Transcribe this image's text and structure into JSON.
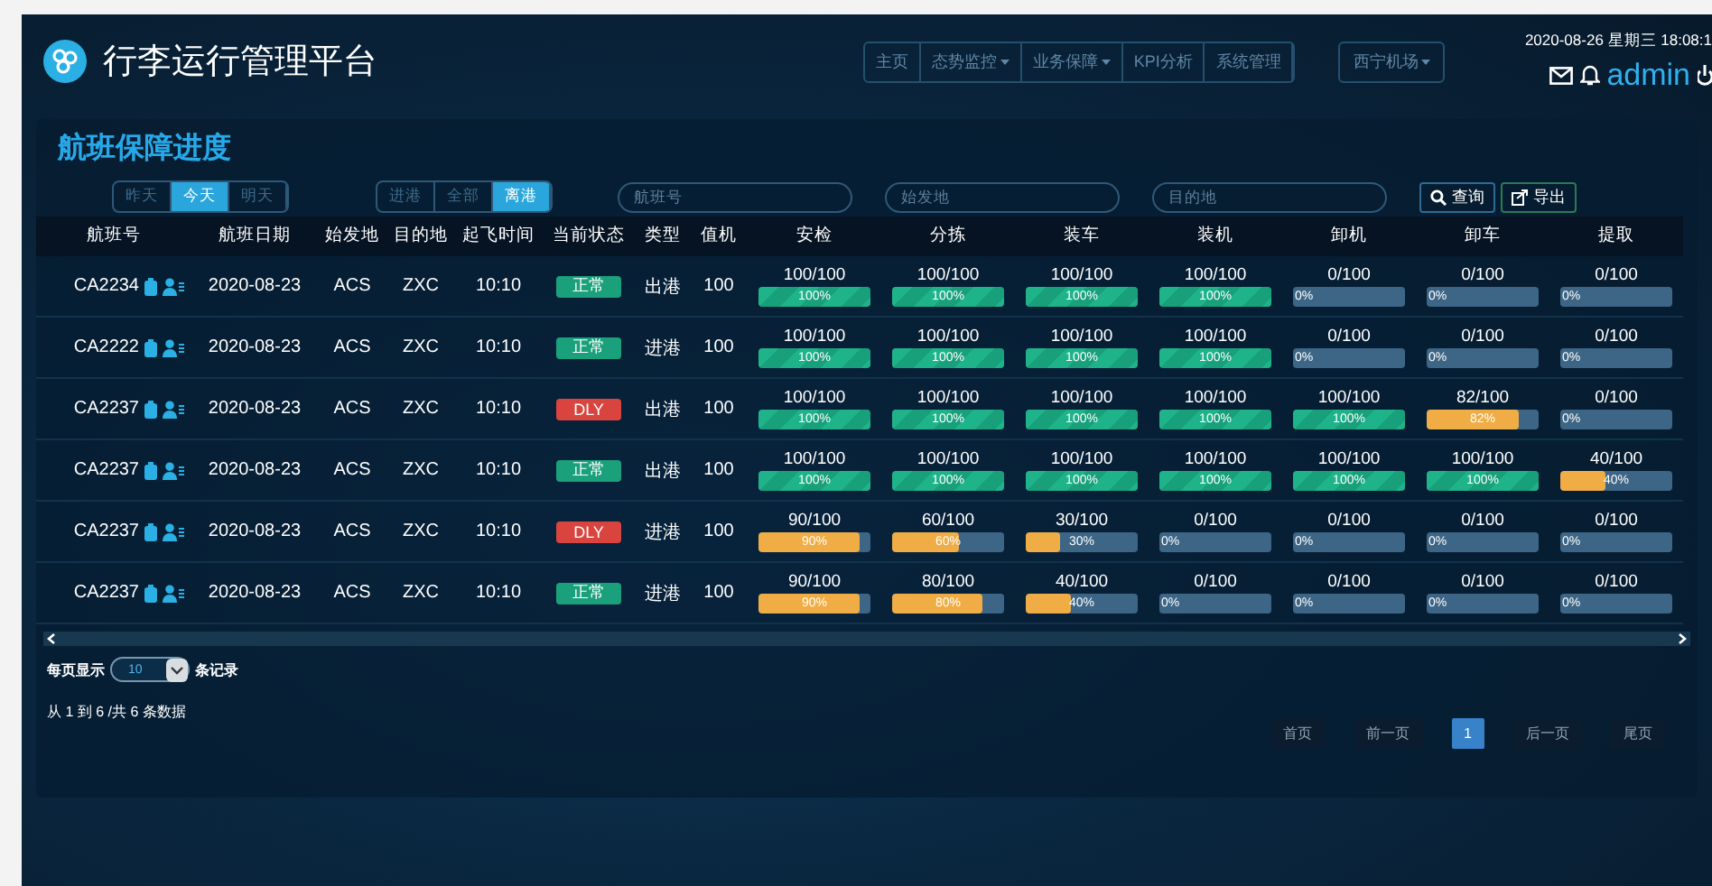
{
  "header": {
    "title": "行李运行管理平台",
    "datetime": "2020-08-26  星期三  18:08:1",
    "user": "admin",
    "nav": [
      {
        "label": "主页",
        "dropdown": false
      },
      {
        "label": "态势监控",
        "dropdown": true
      },
      {
        "label": "业务保障",
        "dropdown": true
      },
      {
        "label": "KPI分析",
        "dropdown": false
      },
      {
        "label": "系统管理",
        "dropdown": false
      }
    ],
    "airport": {
      "label": "西宁机场",
      "dropdown": true
    }
  },
  "panel": {
    "title": "航班保障进度",
    "day_tabs": [
      {
        "label": "昨天",
        "selected": false
      },
      {
        "label": "今天",
        "selected": true
      },
      {
        "label": "明天",
        "selected": false
      }
    ],
    "direction_tabs": [
      {
        "label": "进港",
        "selected": false
      },
      {
        "label": "全部",
        "selected": false
      },
      {
        "label": "离港",
        "selected": true
      }
    ],
    "filters": [
      {
        "placeholder": "航班号"
      },
      {
        "placeholder": "始发地"
      },
      {
        "placeholder": "目的地"
      }
    ],
    "buttons": [
      {
        "label": "查询",
        "kind": "search"
      },
      {
        "label": "导出",
        "kind": "export"
      }
    ],
    "columns": [
      "航班号",
      "航班日期",
      "始发地",
      "目的地",
      "起飞时间",
      "当前状态",
      "类型",
      "值机",
      "安检",
      "分拣",
      "装车",
      "装机",
      "卸机",
      "卸车",
      "提取"
    ],
    "rows": [
      {
        "flight": "CA2234",
        "date": "2020-08-23",
        "origin": "ACS",
        "dest": "ZXC",
        "time": "10:10",
        "status": {
          "text": "正常",
          "kind": "normal"
        },
        "type": "出港",
        "checkin": "100",
        "progress": [
          {
            "reading": "100/100",
            "label": "100%",
            "level": 1
          },
          {
            "reading": "100/100",
            "label": "100%",
            "level": 1
          },
          {
            "reading": "100/100",
            "label": "100%",
            "level": 1
          },
          {
            "reading": "100/100",
            "label": "100%",
            "level": 1
          },
          {
            "reading": "0/100",
            "label": "0%",
            "level": 0
          },
          {
            "reading": "0/100",
            "label": "0%",
            "level": 0
          },
          {
            "reading": "0/100",
            "label": "0%",
            "level": 0
          }
        ]
      },
      {
        "flight": "CA2222",
        "date": "2020-08-23",
        "origin": "ACS",
        "dest": "ZXC",
        "time": "10:10",
        "status": {
          "text": "正常",
          "kind": "normal"
        },
        "type": "进港",
        "checkin": "100",
        "progress": [
          {
            "reading": "100/100",
            "label": "100%",
            "level": 1
          },
          {
            "reading": "100/100",
            "label": "100%",
            "level": 1
          },
          {
            "reading": "100/100",
            "label": "100%",
            "level": 1
          },
          {
            "reading": "100/100",
            "label": "100%",
            "level": 1
          },
          {
            "reading": "0/100",
            "label": "0%",
            "level": 0
          },
          {
            "reading": "0/100",
            "label": "0%",
            "level": 0
          },
          {
            "reading": "0/100",
            "label": "0%",
            "level": 0
          }
        ]
      },
      {
        "flight": "CA2237",
        "date": "2020-08-23",
        "origin": "ACS",
        "dest": "ZXC",
        "time": "10:10",
        "status": {
          "text": "DLY",
          "kind": "delayed"
        },
        "type": "出港",
        "checkin": "100",
        "progress": [
          {
            "reading": "100/100",
            "label": "100%",
            "level": 1
          },
          {
            "reading": "100/100",
            "label": "100%",
            "level": 1
          },
          {
            "reading": "100/100",
            "label": "100%",
            "level": 1
          },
          {
            "reading": "100/100",
            "label": "100%",
            "level": 1
          },
          {
            "reading": "100/100",
            "label": "100%",
            "level": 1
          },
          {
            "reading": "82/100",
            "label": "82%",
            "level": 0.82
          },
          {
            "reading": "0/100",
            "label": "0%",
            "level": 0
          }
        ]
      },
      {
        "flight": "CA2237",
        "date": "2020-08-23",
        "origin": "ACS",
        "dest": "ZXC",
        "time": "10:10",
        "status": {
          "text": "正常",
          "kind": "normal"
        },
        "type": "出港",
        "checkin": "100",
        "progress": [
          {
            "reading": "100/100",
            "label": "100%",
            "level": 1
          },
          {
            "reading": "100/100",
            "label": "100%",
            "level": 1
          },
          {
            "reading": "100/100",
            "label": "100%",
            "level": 1
          },
          {
            "reading": "100/100",
            "label": "100%",
            "level": 1
          },
          {
            "reading": "100/100",
            "label": "100%",
            "level": 1
          },
          {
            "reading": "100/100",
            "label": "100%",
            "level": 1
          },
          {
            "reading": "40/100",
            "label": "40%",
            "level": 0.4
          }
        ]
      },
      {
        "flight": "CA2237",
        "date": "2020-08-23",
        "origin": "ACS",
        "dest": "ZXC",
        "time": "10:10",
        "status": {
          "text": "DLY",
          "kind": "delayed"
        },
        "type": "进港",
        "checkin": "100",
        "progress": [
          {
            "reading": "90/100",
            "label": "90%",
            "level": 0.9
          },
          {
            "reading": "60/100",
            "label": "60%",
            "level": 0.6
          },
          {
            "reading": "30/100",
            "label": "30%",
            "level": 0.3
          },
          {
            "reading": "0/100",
            "label": "0%",
            "level": 0
          },
          {
            "reading": "0/100",
            "label": "0%",
            "level": 0
          },
          {
            "reading": "0/100",
            "label": "0%",
            "level": 0
          },
          {
            "reading": "0/100",
            "label": "0%",
            "level": 0
          }
        ]
      },
      {
        "flight": "CA2237",
        "date": "2020-08-23",
        "origin": "ACS",
        "dest": "ZXC",
        "time": "10:10",
        "status": {
          "text": "正常",
          "kind": "normal"
        },
        "type": "进港",
        "checkin": "100",
        "progress": [
          {
            "reading": "90/100",
            "label": "90%",
            "level": 0.9
          },
          {
            "reading": "80/100",
            "label": "80%",
            "level": 0.8
          },
          {
            "reading": "40/100",
            "label": "40%",
            "level": 0.4
          },
          {
            "reading": "0/100",
            "label": "0%",
            "level": 0
          },
          {
            "reading": "0/100",
            "label": "0%",
            "level": 0
          },
          {
            "reading": "0/100",
            "label": "0%",
            "level": 0
          },
          {
            "reading": "0/100",
            "label": "0%",
            "level": 0
          }
        ]
      }
    ],
    "page_size": {
      "prefix": "每页显示",
      "value": "10",
      "suffix": "条记录"
    },
    "summary": "从 1 到 6 /共 6 条数据",
    "pagination": [
      {
        "label": "首页",
        "selected": false
      },
      {
        "label": "前一页",
        "selected": false
      },
      {
        "label": "1",
        "selected": true
      },
      {
        "label": "后一页",
        "selected": false
      },
      {
        "label": "尾页",
        "selected": false
      }
    ]
  }
}
